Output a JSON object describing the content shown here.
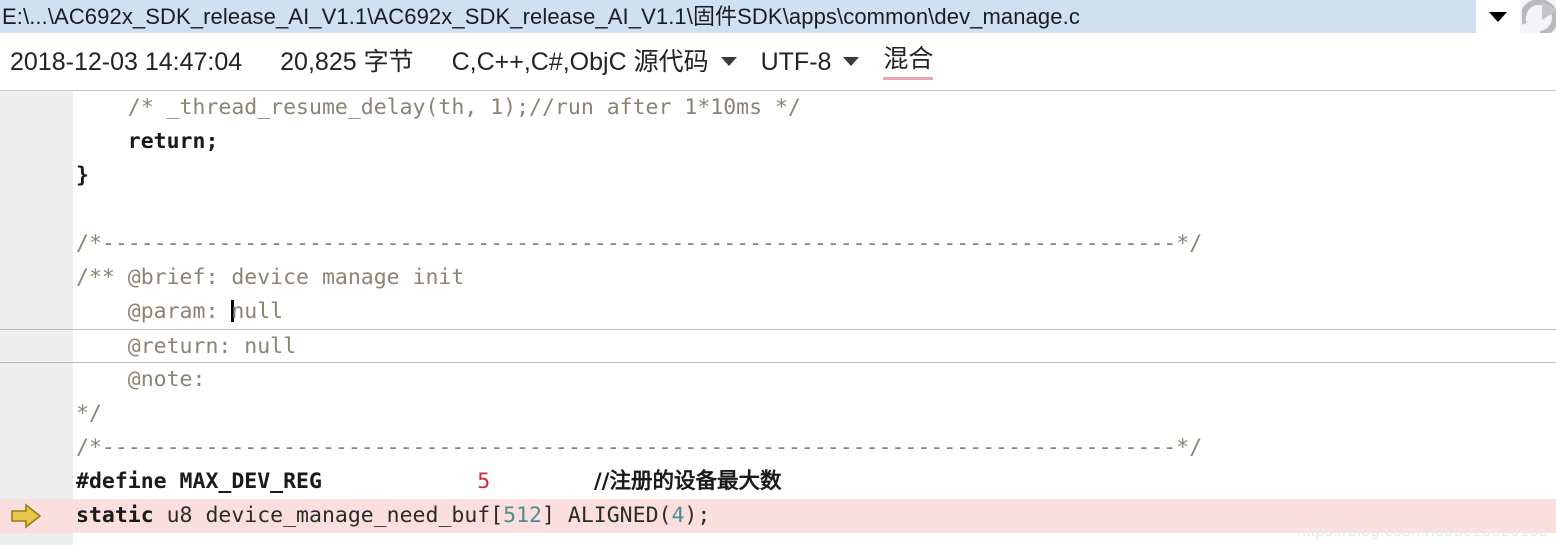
{
  "titlebar": {
    "path": "E:\\...\\AC692x_SDK_release_AI_V1.1\\AC692x_SDK_release_AI_V1.1\\固件SDK\\apps\\common\\dev_manage.c",
    "dropdown_icon": "chevron-down-icon",
    "refresh_icon": "refresh-icon",
    "field_color": "#cfe0f2"
  },
  "infobar": {
    "datetime": "2018-12-03 14:47:04",
    "size": "20,825 字节",
    "filetype": "C,C++,C#,ObjC 源代码",
    "filetype_caret": "caret-down-icon",
    "encoding": "UTF-8",
    "encoding_caret": "caret-down-icon",
    "linebreak": "混合",
    "linebreak_underline_color": "#e9a6ae"
  },
  "editor": {
    "gutter_marker_icon": "bookmark-arrow-icon",
    "current_line_index": 7,
    "highlight_line_index": 12,
    "highlight_color": "#fbdfdf",
    "lines": [
      {
        "indent": 0,
        "segs": [
          {
            "t": "    /* _thread_resume_delay(th, 1);//run after 1*10ms */",
            "c": "cmt"
          }
        ]
      },
      {
        "indent": 0,
        "segs": [
          {
            "t": "    ",
            "c": "plain"
          },
          {
            "t": "return;",
            "c": "kw"
          }
        ]
      },
      {
        "indent": 0,
        "segs": [
          {
            "t": "}",
            "c": "kw"
          }
        ]
      },
      {
        "indent": 0,
        "segs": [
          {
            "t": "",
            "c": "plain"
          }
        ]
      },
      {
        "indent": 0,
        "segs": [
          {
            "t": "/*-----------------------------------------------------------------------------------*/",
            "c": "cmt"
          }
        ]
      },
      {
        "indent": 0,
        "segs": [
          {
            "t": "/** @brief: device manage init",
            "c": "cmt"
          }
        ]
      },
      {
        "indent": 0,
        "segs": [
          {
            "t": "    @param: ",
            "c": "cmt"
          },
          {
            "t": "CARET",
            "c": "caret"
          },
          {
            "t": "null",
            "c": "cmt"
          }
        ]
      },
      {
        "indent": 0,
        "segs": [
          {
            "t": "    @return: null",
            "c": "cmt"
          }
        ]
      },
      {
        "indent": 0,
        "segs": [
          {
            "t": "    @note:",
            "c": "cmt"
          }
        ]
      },
      {
        "indent": 0,
        "segs": [
          {
            "t": "*/",
            "c": "cmt"
          }
        ]
      },
      {
        "indent": 0,
        "segs": [
          {
            "t": "/*-----------------------------------------------------------------------------------*/",
            "c": "cmt"
          }
        ]
      },
      {
        "indent": 0,
        "segs": [
          {
            "t": "#define MAX_DEV_REG",
            "c": "kw"
          },
          {
            "t": "            ",
            "c": "plain"
          },
          {
            "t": "5",
            "c": "num-red"
          },
          {
            "t": "        ",
            "c": "plain"
          },
          {
            "t": "//注册的设备最大数",
            "c": "cn-kw"
          }
        ]
      },
      {
        "indent": 0,
        "segs": [
          {
            "t": "static",
            "c": "kw"
          },
          {
            "t": " u8 device_manage_need_buf[",
            "c": "plain"
          },
          {
            "t": "512",
            "c": "num-teal"
          },
          {
            "t": "] ALIGNED(",
            "c": "plain"
          },
          {
            "t": "4",
            "c": "num-teal"
          },
          {
            "t": ");",
            "c": "plain"
          }
        ]
      }
    ]
  },
  "watermark": {
    "text": "https://blog.csdn.net/u013820168"
  }
}
